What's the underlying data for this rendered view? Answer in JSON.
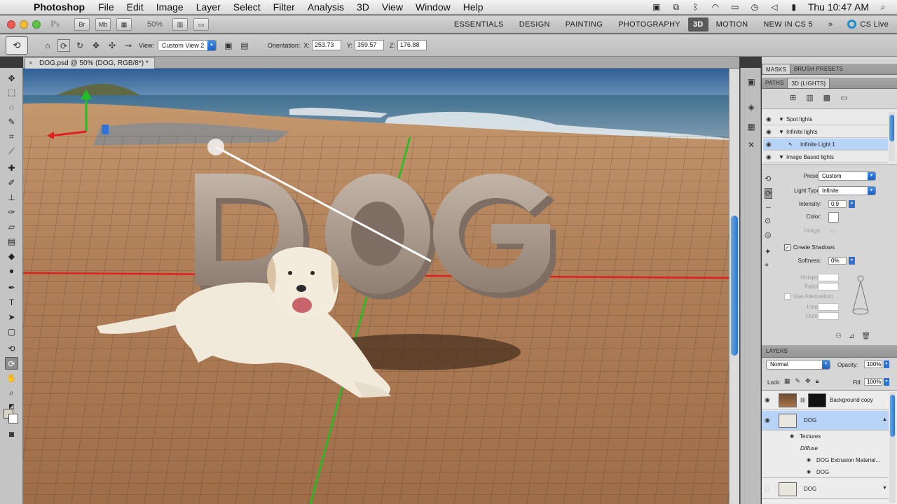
{
  "menubar": {
    "app_name": "Photoshop",
    "items": [
      "File",
      "Edit",
      "Image",
      "Layer",
      "Select",
      "Filter",
      "Analysis",
      "3D",
      "View",
      "Window",
      "Help"
    ],
    "clock": "Thu 10:47 AM"
  },
  "appbar": {
    "ps_logo": "Ps",
    "zoom": "50%",
    "workspaces": [
      "ESSENTIALS",
      "DESIGN",
      "PAINTING",
      "PHOTOGRAPHY",
      "3D",
      "MOTION",
      "NEW IN CS 5"
    ],
    "active_workspace": "3D",
    "more": "»",
    "cs_live": "CS Live"
  },
  "options": {
    "view_label": "View:",
    "view_value": "Custom View 2",
    "orientation_label": "Orientation:",
    "x_label": "X:",
    "x_value": "253.73",
    "y_label": "Y:",
    "y_value": "359.57",
    "z_label": "Z:",
    "z_value": "176.88"
  },
  "document": {
    "tab_title": "DOG.psd @ 50% (DOG, RGB/8*) *",
    "text_3d": "DOG"
  },
  "panels": {
    "top_tabs": [
      "MASKS",
      "BRUSH PRESETS"
    ],
    "second_tabs": [
      "PATHS",
      "3D {LIGHTS}"
    ],
    "lights": [
      {
        "label": "Spot lights",
        "type": "group"
      },
      {
        "label": "Infinite lights",
        "type": "group"
      },
      {
        "label": "Infinite Light 1",
        "type": "item",
        "selected": true
      },
      {
        "label": "Image Based lights",
        "type": "group"
      }
    ],
    "preset_label": "Preset:",
    "preset_value": "Custom",
    "light_type_label": "Light Type:",
    "light_type_value": "Infinite",
    "intensity_label": "Intensity:",
    "intensity_value": "0.9",
    "color_label": "Color:",
    "image_label": "Image:",
    "create_shadows_label": "Create Shadows",
    "softness_label": "Softness:",
    "softness_value": "0%",
    "hotspot_label": "Hotspot:",
    "falloff_label": "Falloff:",
    "use_attenuation_label": "Use Attenuation",
    "inner_label": "Inner:",
    "outer_label": "Outer:"
  },
  "layers": {
    "title": "LAYERS",
    "blend_mode": "Normal",
    "opacity_label": "Opacity:",
    "opacity_value": "100%",
    "lock_label": "Lock:",
    "fill_label": "Fill:",
    "fill_value": "100%",
    "rows": [
      {
        "name": "Background copy"
      },
      {
        "name": "DOG",
        "selected": true
      },
      {
        "name": "Textures"
      },
      {
        "name": "Diffuse"
      },
      {
        "name": "DOG Extrusion Material..."
      },
      {
        "name": "DOG"
      },
      {
        "name": "DOG"
      }
    ]
  },
  "colors": {
    "accent_blue": "#2d73cf",
    "selection_blue": "#b7d3f7",
    "x_axis": "#e02020",
    "y_axis": "#20c020"
  }
}
